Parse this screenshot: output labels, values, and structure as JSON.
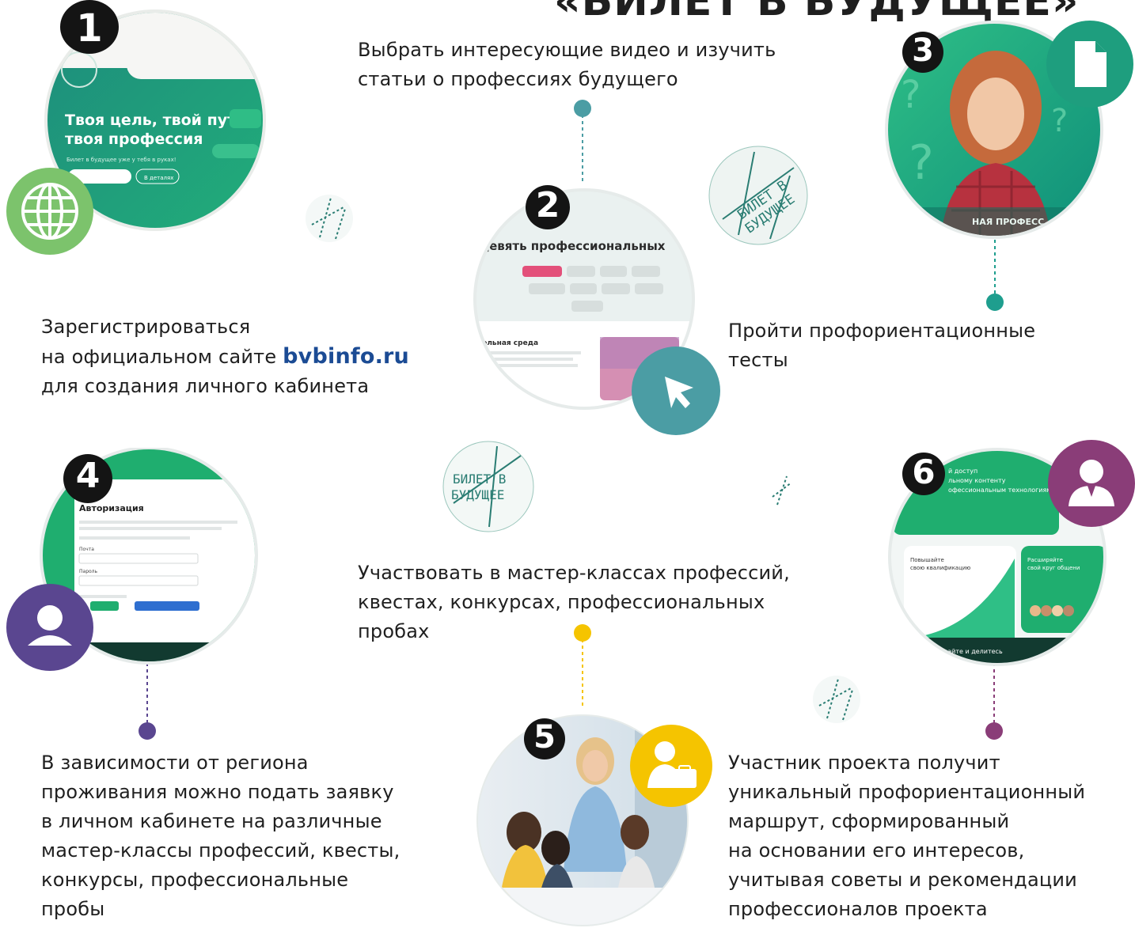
{
  "header": {
    "title": "«БИЛЕТ В БУДУЩЕЕ»"
  },
  "steps": [
    {
      "number": "1"
    },
    {
      "number": "2"
    },
    {
      "number": "3"
    },
    {
      "number": "4"
    },
    {
      "number": "5"
    },
    {
      "number": "6"
    }
  ],
  "texts": {
    "step1_line1": "Зарегистрироваться",
    "step1_line2_pre": "на официальном сайте ",
    "step1_url": "bvbinfo.ru",
    "step1_line3": "для создания личного кабинета",
    "step2_line1": "Выбрать интересующие видео и изучить",
    "step2_line2": "статьи о профессиях будущего",
    "step3_line1": "Пройти профориентационные",
    "step3_line2": "тесты",
    "step4_lines": [
      "В зависимости от региона",
      "проживания можно подать заявку",
      "в личном кабинете на различные",
      "мастер-классы профессий, квесты,",
      "конкурсы, профессиональные",
      "пробы"
    ],
    "step5_lines": [
      "Участвовать в мастер-классах профессий,",
      "квестах, конкурсах, профессиональных",
      "пробах"
    ],
    "step6_lines": [
      "Участник проекта получит",
      "уникальный профориентационный",
      "маршрут, сформированный",
      "на основании его интересов,",
      "учитывая советы и рекомендации",
      "профессионалов проекта"
    ]
  },
  "screens": {
    "s1_headline_1": "Твоя цель, твой путь,",
    "s1_headline_2": "твоя профессия",
    "s1_sub": "Билет в будущее уже у тебя в руках!",
    "s1_btn": "В деталях",
    "s2_headline": "девять профессиональных",
    "s2_section": "тельная среда",
    "s3_caption": "НАЯ ПРОФЕСС",
    "s4_title": "Авторизация",
    "s4_field1": "Почта",
    "s4_field2": "Пароль",
    "s6_card1_1": "й доступ",
    "s6_card1_2": "льному контенту",
    "s6_card1_3": "офессиональным технологиям",
    "s6_card2_1": "Повышайте",
    "s6_card2_2": "свою квалификацию",
    "s6_card3_1": "Расширяйте",
    "s6_card3_2": "свой круг общени",
    "s6_bottom": "найте и делитесь"
  },
  "stamp": {
    "text_1": "БИЛЕТ В",
    "text_2": "БУДУЩЕЕ"
  },
  "colors": {
    "green": "#1fad6f",
    "teal": "#1e9e8e",
    "light_green": "#7cc36c",
    "steel_teal": "#4b9da4",
    "purple": "#5a4690",
    "yellow": "#f5c400",
    "plum": "#8a3d78",
    "url_blue": "#1b4b94"
  },
  "icons": [
    "globe-icon",
    "cursor-icon",
    "document-icon",
    "user-icon",
    "teacher-icon",
    "businessman-icon"
  ]
}
